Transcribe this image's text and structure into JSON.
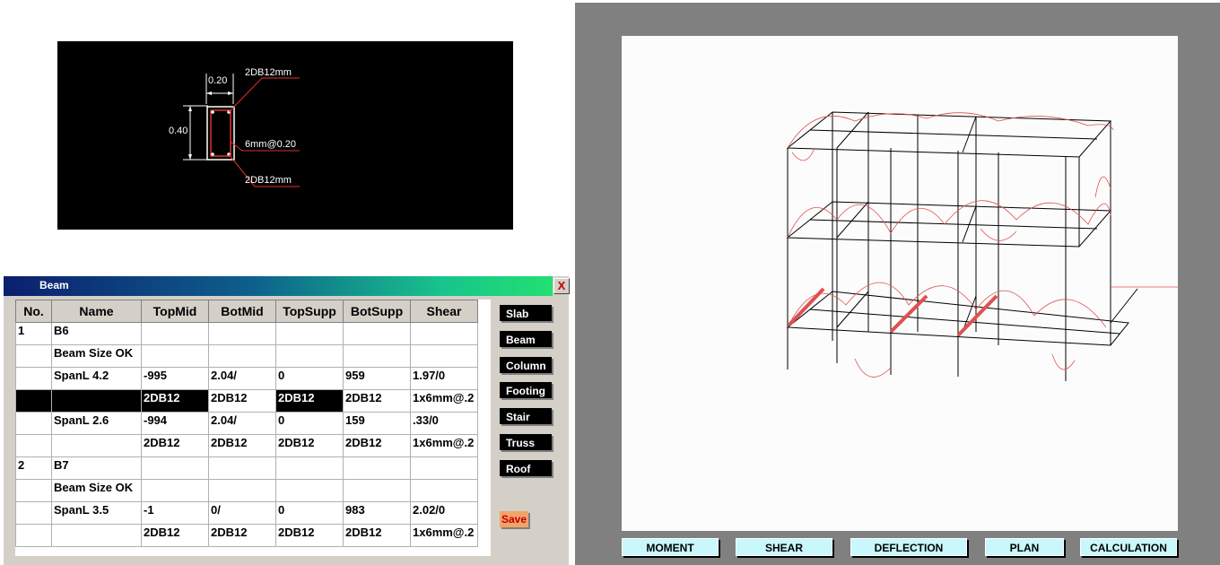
{
  "section": {
    "width_label": "0.20",
    "height_label": "0.40",
    "top_bar": "2DB12mm",
    "stirrup": "6mm@0.20",
    "bottom_bar": "2DB12mm"
  },
  "beam_window": {
    "title": "Beam",
    "close_label": "X",
    "columns": [
      "No.",
      "Name",
      "TopMid",
      "BotMid",
      "TopSupp",
      "BotSupp",
      "Shear"
    ],
    "rows": [
      [
        "1",
        "B6",
        "",
        "",
        "",
        "",
        ""
      ],
      [
        "",
        "Beam Size OK",
        "",
        "",
        "",
        "",
        ""
      ],
      [
        "",
        "SpanL 4.2",
        "-995",
        "2.04/",
        "0",
        "959",
        "1.97/0"
      ],
      [
        "",
        "",
        "2DB12",
        "2DB12",
        "2DB12",
        "2DB12",
        "1x6mm@.2"
      ],
      [
        "",
        "SpanL 2.6",
        "-994",
        "2.04/",
        "0",
        "159",
        ".33/0"
      ],
      [
        "",
        "",
        "2DB12",
        "2DB12",
        "2DB12",
        "2DB12",
        "1x6mm@.2"
      ],
      [
        "2",
        "B7",
        "",
        "",
        "",
        "",
        ""
      ],
      [
        "",
        "Beam Size OK",
        "",
        "",
        "",
        "",
        ""
      ],
      [
        "",
        "SpanL 3.5",
        "-1",
        "0/",
        "0",
        "983",
        "2.02/0"
      ],
      [
        "",
        "",
        "2DB12",
        "2DB12",
        "2DB12",
        "2DB12",
        "1x6mm@.2"
      ]
    ],
    "side_buttons": [
      "Slab",
      "Beam",
      "Column",
      "Footing",
      "Stair",
      "Truss",
      "Roof"
    ],
    "save_label": "Save"
  },
  "view_buttons": [
    "MOMENT",
    "SHEAR",
    "DEFLECTION",
    "PLAN",
    "CALCULATION"
  ],
  "colors": {
    "accent_red": "#e05050",
    "panel_gray": "#808080",
    "button_cyan": "#c8f8fc"
  }
}
